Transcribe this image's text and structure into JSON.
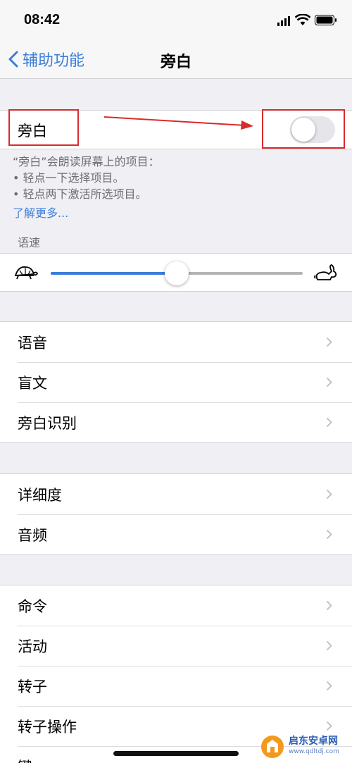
{
  "status_bar": {
    "time": "08:42"
  },
  "nav": {
    "back_label": "辅助功能",
    "title": "旁白"
  },
  "voiceover": {
    "label": "旁白",
    "toggle_on": false
  },
  "footer": {
    "line1": "“旁白”会朗读屏幕上的项目：",
    "line2": "• 轻点一下选择项目。",
    "line3": "• 轻点两下激活所选项目。",
    "learn_more": "了解更多..."
  },
  "speech_rate": {
    "header": "语速",
    "level": 0.5
  },
  "group1": [
    "语音",
    "盲文",
    "旁白识别"
  ],
  "group2": [
    "详细度",
    "音频"
  ],
  "group3": [
    "命令",
    "活动",
    "转子",
    "转子操作",
    "键…"
  ],
  "watermark": {
    "name": "启东安卓网",
    "url": "www.qdltdj.com"
  },
  "colors": {
    "accent": "#3b7dd8",
    "annotation": "#d92b2b"
  }
}
